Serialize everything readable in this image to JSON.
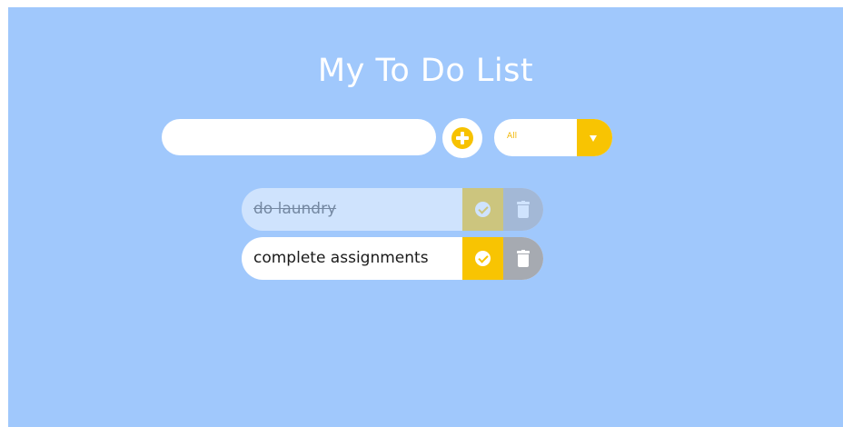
{
  "header": {
    "title": "My To Do List"
  },
  "form": {
    "input_value": "",
    "input_placeholder": "",
    "add_icon": "plus-circle-icon",
    "filter": {
      "selected": "All",
      "icon": "caret-down-icon"
    }
  },
  "todos": [
    {
      "text": "do laundry",
      "completed": true
    },
    {
      "text": "complete assignments",
      "completed": false
    }
  ],
  "colors": {
    "background": "#a0c8fc",
    "accent": "#f8c402",
    "delete": "#a6aab1",
    "surface": "#ffffff"
  }
}
